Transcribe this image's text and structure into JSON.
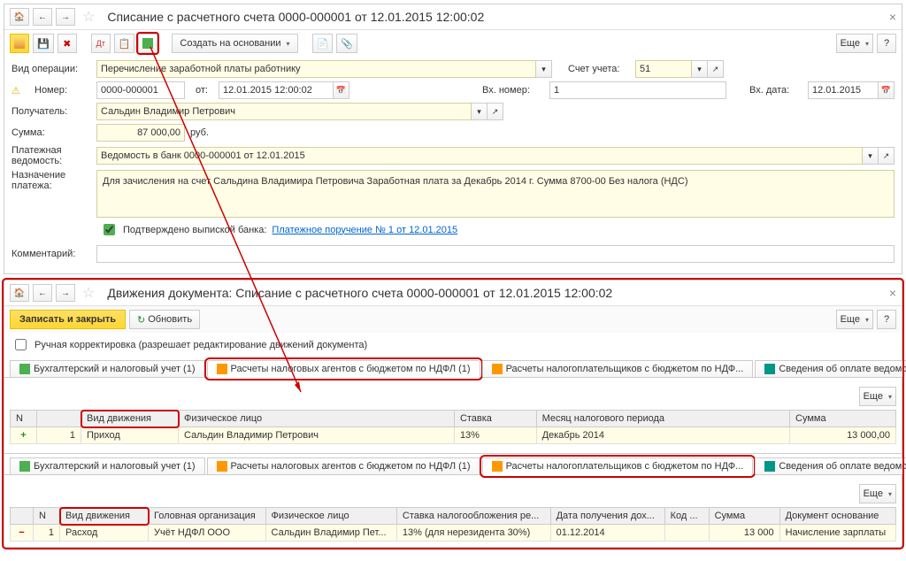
{
  "top": {
    "title": "Списание с расчетного счета 0000-000001 от 12.01.2015 12:00:02",
    "create_based": "Создать на основании",
    "more": "Еще",
    "help": "?",
    "operation_label": "Вид операции:",
    "operation_value": "Перечисление заработной платы работнику",
    "account_label": "Счет учета:",
    "account_value": "51",
    "number_label": "Номер:",
    "number_value": "0000-000001",
    "date_from": "от:",
    "date_value": "12.01.2015 12:00:02",
    "in_number_label": "Вх. номер:",
    "in_number_value": "1",
    "in_date_label": "Вх. дата:",
    "in_date_value": "12.01.2015",
    "recipient_label": "Получатель:",
    "recipient_value": "Сальдин Владимир Петрович",
    "amount_label": "Сумма:",
    "amount_value": "87 000,00",
    "currency": "руб.",
    "vedomost_label": "Платежная ведомость:",
    "vedomost_value": "Ведомость в банк 0000-000001 от 12.01.2015",
    "purpose_label": "Назначение платежа:",
    "purpose_value": "Для зачисления на счет Сальдина Владимира Петровича Заработная плата за Декабрь 2014 г. Сумма 8700-00 Без налога (НДС)",
    "confirmed_label": "Подтверждено выпиской банка:",
    "payment_link": "Платежное поручение № 1 от 12.01.2015",
    "comment_label": "Комментарий:"
  },
  "bottom": {
    "title": "Движения документа: Списание с расчетного счета 0000-000001 от 12.01.2015 12:00:02",
    "save_close": "Записать и закрыть",
    "refresh": "Обновить",
    "more": "Еще",
    "help": "?",
    "manual_label": "Ручная корректировка (разрешает редактирование движений документа)",
    "tabs": {
      "t1": "Бухгалтерский и налоговый учет (1)",
      "t2": "Расчеты налоговых агентов с бюджетом по НДФЛ (1)",
      "t3": "Расчеты налогоплательщиков с бюджетом по НДФ...",
      "t4": "Сведения об оплате ведомостей на выплату зарабо..."
    },
    "table1": {
      "cols": {
        "n": "N",
        "vid": "Вид движения",
        "fiz": "Физическое лицо",
        "stavka": "Ставка",
        "month": "Месяц налогового периода",
        "sum": "Сумма"
      },
      "row": {
        "n": "1",
        "vid": "Приход",
        "fiz": "Сальдин Владимир Петрович",
        "stavka": "13%",
        "month": "Декабрь 2014",
        "sum": "13 000,00"
      }
    },
    "table2": {
      "cols": {
        "n": "N",
        "vid": "Вид движения",
        "org": "Головная организация",
        "fiz": "Физическое лицо",
        "stavka": "Ставка налогообложения ре...",
        "date": "Дата получения дох...",
        "kod": "Код ...",
        "sum": "Сумма",
        "doc": "Документ основание"
      },
      "row": {
        "n": "1",
        "vid": "Расход",
        "org": "Учёт НДФЛ ООО",
        "fiz": "Сальдин Владимир Пет...",
        "stavka": "13% (для нерезидента 30%)",
        "date": "01.12.2014",
        "kod": "",
        "sum": "13 000",
        "doc": "Начисление зарплаты"
      }
    }
  }
}
